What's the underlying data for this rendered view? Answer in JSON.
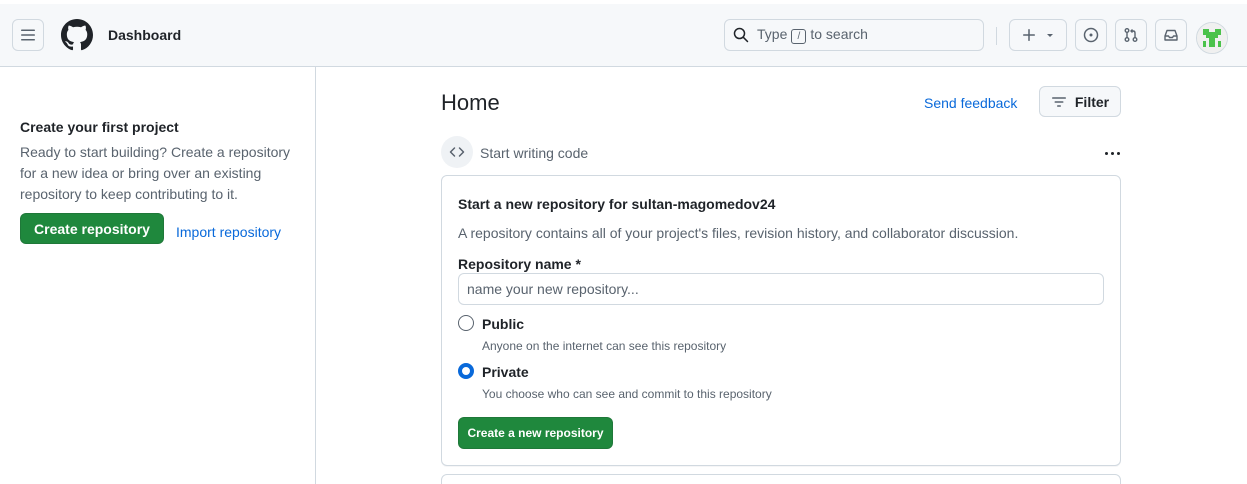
{
  "header": {
    "title": "Dashboard",
    "search": {
      "prefix": "Type",
      "key": "/",
      "suffix": "to search"
    }
  },
  "sidebar": {
    "heading": "Create your first project",
    "text": "Ready to start building? Create a repository for a new idea or bring over an existing repository to keep contributing to it.",
    "create_button": "Create repository",
    "import_link": "Import repository"
  },
  "main": {
    "title": "Home",
    "send_feedback": "Send feedback",
    "filter_label": "Filter",
    "section_label": "Start writing code"
  },
  "card": {
    "title": "Start a new repository for sultan-magomedov24",
    "description": "A repository contains all of your project's files, revision history, and collaborator discussion.",
    "repo_name_label": "Repository name *",
    "repo_name_placeholder": "name your new repository...",
    "repo_name_value": "",
    "options": [
      {
        "label": "Public",
        "description": "Anyone on the internet can see this repository",
        "selected": false
      },
      {
        "label": "Private",
        "description": "You choose who can see and commit to this repository",
        "selected": true
      }
    ],
    "create_button": "Create a new repository"
  },
  "colors": {
    "primary_green": "#1f883d",
    "link_blue": "#0969da",
    "border": "#d1d9e0",
    "header_bg": "#f6f8fa",
    "muted_text": "#59636e"
  },
  "icons": [
    "hamburger-icon",
    "github-logo-icon",
    "search-icon",
    "plus-icon",
    "triangle-down-icon",
    "issue-opened-icon",
    "git-pull-request-icon",
    "inbox-icon",
    "filter-icon",
    "code-icon",
    "kebab-horizontal-icon"
  ]
}
